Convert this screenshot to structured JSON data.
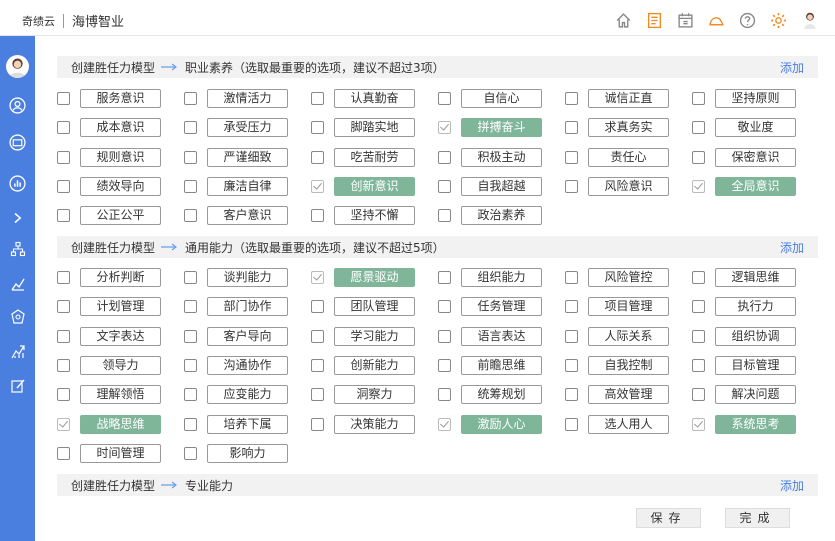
{
  "header": {
    "logo_text": "奇绩云",
    "product": "海博智业",
    "icons": [
      "home-icon",
      "report-icon",
      "calendar-icon",
      "cloud-icon",
      "help-icon",
      "settings-icon",
      "user-avatar"
    ]
  },
  "sidebar": {
    "icons": [
      "avatar",
      "user-icon",
      "id-card-icon",
      "chart-icon",
      "expand-icon",
      "org-icon",
      "trend-icon",
      "badge-icon",
      "growth-icon",
      "edit-icon"
    ]
  },
  "sections": [
    {
      "title": "创建胜任力模型",
      "subtitle": "职业素养（选取最重要的选项，建议不超过3项）",
      "add_label": "添加",
      "options": [
        {
          "label": "服务意识",
          "checked": false
        },
        {
          "label": "激情活力",
          "checked": false
        },
        {
          "label": "认真勤奋",
          "checked": false
        },
        {
          "label": "自信心",
          "checked": false
        },
        {
          "label": "诚信正直",
          "checked": false
        },
        {
          "label": "坚持原则",
          "checked": false
        },
        {
          "label": "成本意识",
          "checked": false
        },
        {
          "label": "承受压力",
          "checked": false
        },
        {
          "label": "脚踏实地",
          "checked": false
        },
        {
          "label": "拼搏奋斗",
          "checked": true
        },
        {
          "label": "求真务实",
          "checked": false
        },
        {
          "label": "敬业度",
          "checked": false
        },
        {
          "label": "规则意识",
          "checked": false
        },
        {
          "label": "严谨细致",
          "checked": false
        },
        {
          "label": "吃苦耐劳",
          "checked": false
        },
        {
          "label": "积极主动",
          "checked": false
        },
        {
          "label": "责任心",
          "checked": false
        },
        {
          "label": "保密意识",
          "checked": false
        },
        {
          "label": "绩效导向",
          "checked": false
        },
        {
          "label": "廉洁自律",
          "checked": false
        },
        {
          "label": "创新意识",
          "checked": true
        },
        {
          "label": "自我超越",
          "checked": false
        },
        {
          "label": "风险意识",
          "checked": false
        },
        {
          "label": "全局意识",
          "checked": true
        },
        {
          "label": "公正公平",
          "checked": false
        },
        {
          "label": "客户意识",
          "checked": false
        },
        {
          "label": "坚持不懈",
          "checked": false
        },
        {
          "label": "政治素养",
          "checked": false
        }
      ]
    },
    {
      "title": "创建胜任力模型",
      "subtitle": "通用能力（选取最重要的选项，建议不超过5项）",
      "add_label": "添加",
      "options": [
        {
          "label": "分析判断",
          "checked": false
        },
        {
          "label": "谈判能力",
          "checked": false
        },
        {
          "label": "愿景驱动",
          "checked": true
        },
        {
          "label": "组织能力",
          "checked": false
        },
        {
          "label": "风险管控",
          "checked": false
        },
        {
          "label": "逻辑思维",
          "checked": false
        },
        {
          "label": "计划管理",
          "checked": false
        },
        {
          "label": "部门协作",
          "checked": false
        },
        {
          "label": "团队管理",
          "checked": false
        },
        {
          "label": "任务管理",
          "checked": false
        },
        {
          "label": "项目管理",
          "checked": false
        },
        {
          "label": "执行力",
          "checked": false
        },
        {
          "label": "文字表达",
          "checked": false
        },
        {
          "label": "客户导向",
          "checked": false
        },
        {
          "label": "学习能力",
          "checked": false
        },
        {
          "label": "语言表达",
          "checked": false
        },
        {
          "label": "人际关系",
          "checked": false
        },
        {
          "label": "组织协调",
          "checked": false
        },
        {
          "label": "领导力",
          "checked": false
        },
        {
          "label": "沟通协作",
          "checked": false
        },
        {
          "label": "创新能力",
          "checked": false
        },
        {
          "label": "前瞻思维",
          "checked": false
        },
        {
          "label": "自我控制",
          "checked": false
        },
        {
          "label": "目标管理",
          "checked": false
        },
        {
          "label": "理解领悟",
          "checked": false
        },
        {
          "label": "应变能力",
          "checked": false
        },
        {
          "label": "洞察力",
          "checked": false
        },
        {
          "label": "统筹规划",
          "checked": false
        },
        {
          "label": "高效管理",
          "checked": false
        },
        {
          "label": "解决问题",
          "checked": false
        },
        {
          "label": "战略思维",
          "checked": true
        },
        {
          "label": "培养下属",
          "checked": false
        },
        {
          "label": "决策能力",
          "checked": false
        },
        {
          "label": "激励人心",
          "checked": true
        },
        {
          "label": "选人用人",
          "checked": false
        },
        {
          "label": "系统思考",
          "checked": true
        },
        {
          "label": "时间管理",
          "checked": false
        },
        {
          "label": "影响力",
          "checked": false
        }
      ]
    },
    {
      "title": "创建胜任力模型",
      "subtitle": "专业能力",
      "add_label": "添加",
      "options": []
    }
  ],
  "footer": {
    "save_label": "保存",
    "finish_label": "完成"
  }
}
